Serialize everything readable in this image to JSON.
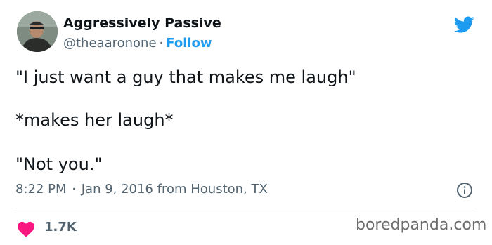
{
  "author": {
    "display_name": "Aggressively Passive",
    "handle": "@theaaronone",
    "separator": "·",
    "follow_label": "Follow"
  },
  "tweet": {
    "lines": [
      "\"I just want a guy that makes me laugh\"",
      "*makes her laugh*",
      "\"Not you.\""
    ],
    "time": "8:22 PM",
    "separator": "·",
    "date_location": "Jan 9, 2016 from Houston, TX"
  },
  "engagement": {
    "likes": "1.7K"
  },
  "watermark": "boredpanda.com",
  "icons": {
    "brand": "twitter-bird-icon",
    "info": "info-icon",
    "like": "heart-icon"
  },
  "colors": {
    "accent": "#1d9bf0",
    "heart": "#f91880",
    "text": "#0f1419",
    "secondary_text": "#536471"
  }
}
